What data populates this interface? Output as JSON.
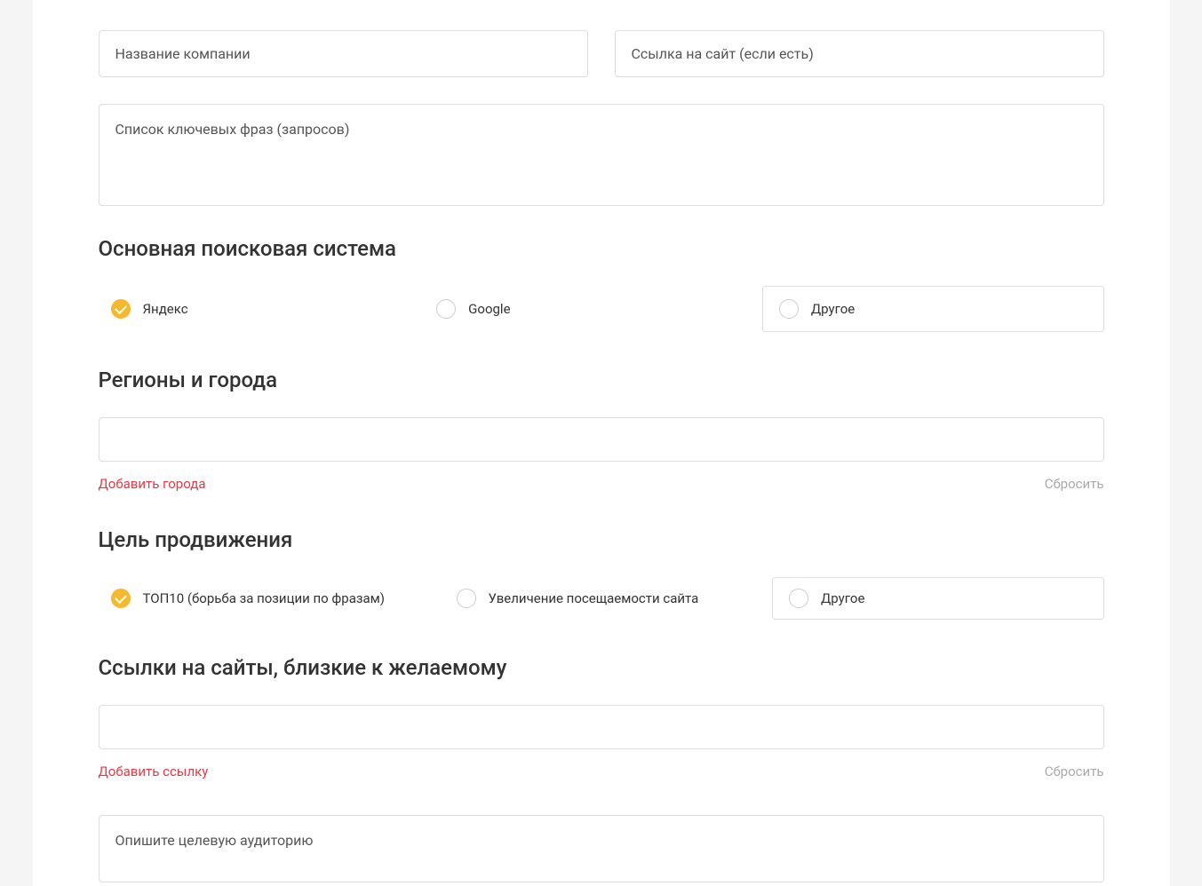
{
  "company": {
    "placeholder": "Название компании"
  },
  "website": {
    "placeholder": "Ссылка на сайт (если есть)"
  },
  "keywords": {
    "placeholder": "Список ключевых фраз (запросов)"
  },
  "searchEngine": {
    "title": "Основная поисковая система",
    "options": {
      "yandex": "Яндекс",
      "google": "Google",
      "other": "Другое"
    }
  },
  "regions": {
    "title": "Регионы и города",
    "addLabel": "Добавить города",
    "resetLabel": "Сбросить"
  },
  "goal": {
    "title": "Цель продвижения",
    "options": {
      "top10": "ТОП10 (борьба за позиции по фразам)",
      "traffic": "Увеличение посещаемости сайта",
      "other": "Другое"
    }
  },
  "similarSites": {
    "title": "Ссылки на сайты, близкие к желаемому",
    "addLabel": "Добавить ссылку",
    "resetLabel": "Сбросить"
  },
  "audience": {
    "placeholder": "Опишите целевую аудиторию"
  }
}
